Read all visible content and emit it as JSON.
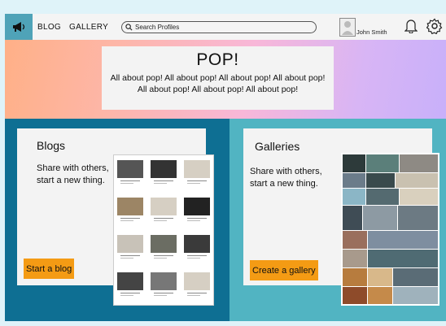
{
  "nav": {
    "links": [
      "BLOG",
      "GALLERY"
    ],
    "search_placeholder": "Search Profiles",
    "user_name": "John Smith",
    "icons": [
      "megaphone-icon",
      "search-icon",
      "avatar",
      "bell-icon",
      "gear-icon"
    ]
  },
  "hero": {
    "title": "POP!",
    "text": "All about pop! All about pop! All about pop! All about pop! All about pop! All about pop! All about pop!"
  },
  "blogs": {
    "title": "Blogs",
    "text": "Share with others, start a new thing.",
    "button": "Start a blog"
  },
  "galleries": {
    "title": "Galleries",
    "text": "Share with others, start a new thing.",
    "button": "Create a gallery"
  },
  "colors": {
    "nav_accent": "#4fa3b8",
    "left_panel": "#0e6f93",
    "right_panel": "#51b4c2",
    "cta": "#f49b14"
  }
}
